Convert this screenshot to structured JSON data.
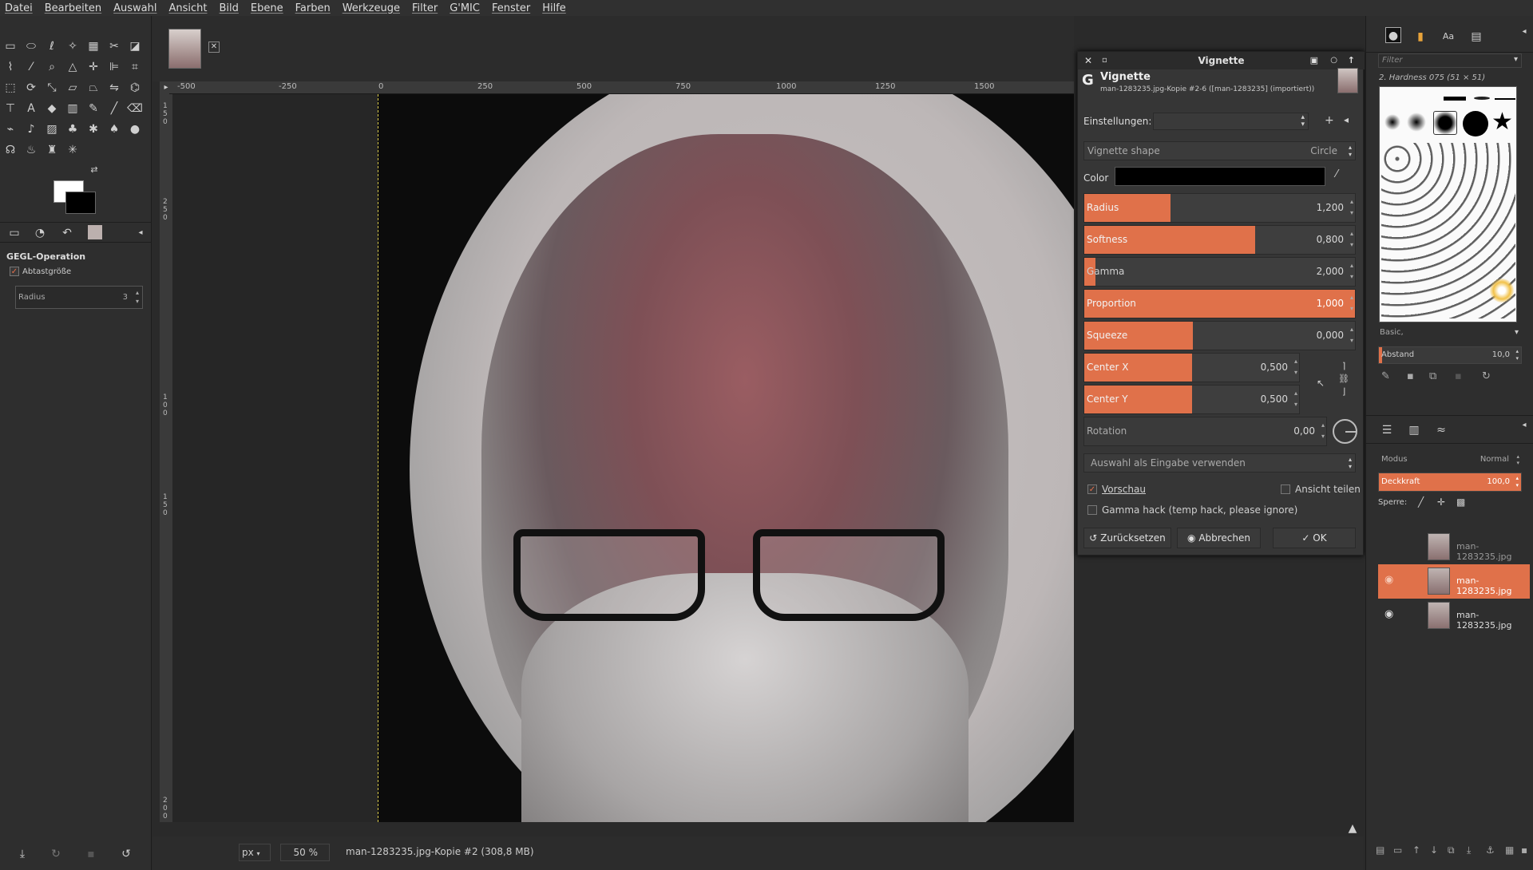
{
  "menubar": [
    "Datei",
    "Bearbeiten",
    "Auswahl",
    "Ansicht",
    "Bild",
    "Ebene",
    "Farben",
    "Werkzeuge",
    "Filter",
    "G'MIC",
    "Fenster",
    "Hilfe"
  ],
  "tool_options": {
    "title": "GEGL-Operation",
    "sample_size_label": "Abtastgröße",
    "radius_label": "Radius",
    "radius_value": "3"
  },
  "ruler": {
    "ticks": [
      "-500",
      "-250",
      "0",
      "250",
      "500",
      "750",
      "1000",
      "1250",
      "1500"
    ]
  },
  "vertical_ruler": [
    "1",
    "5",
    "0",
    "2",
    "5",
    "0",
    "1",
    "0",
    "0",
    "1",
    "5",
    "0",
    "2",
    "0",
    "0"
  ],
  "status": {
    "unit": "px",
    "zoom": "50 %",
    "file": "man-1283235.jpg-Kopie #2 (308,8 MB)"
  },
  "dialog": {
    "window_title": "Vignette",
    "heading": "Vignette",
    "subtitle": "man-1283235.jpg-Kopie #2-6 ([man-1283235] (importiert))",
    "presets_label": "Einstellungen:",
    "shape_label": "Vignette shape",
    "shape_value": "Circle",
    "color_label": "Color",
    "color_value": "#000000",
    "sliders": [
      {
        "label": "Radius",
        "value": "1,200",
        "fraction": 0.32
      },
      {
        "label": "Softness",
        "value": "0,800",
        "fraction": 0.63
      },
      {
        "label": "Gamma",
        "value": "2,000",
        "fraction": 0.04
      },
      {
        "label": "Proportion",
        "value": "1,000",
        "fraction": 1.0
      },
      {
        "label": "Squeeze",
        "value": "0,000",
        "fraction": 0.4
      },
      {
        "label": "Center X",
        "value": "0,500",
        "fraction": 0.5
      },
      {
        "label": "Center Y",
        "value": "0,500",
        "fraction": 0.5
      },
      {
        "label": "Rotation",
        "value": "0,00",
        "fraction": 0.0
      }
    ],
    "input_select": "Auswahl als Eingabe verwenden",
    "preview_label": "Vorschau",
    "split_label": "Ansicht teilen",
    "gamma_hack_label": "Gamma hack (temp hack, please ignore)",
    "reset_label": "Zurücksetzen",
    "cancel_label": "Abbrechen",
    "ok_label": "OK"
  },
  "right_dock": {
    "filter_placeholder": "Filter",
    "brush_name": "2. Hardness 075 (51 × 51)",
    "brush_set": "Basic,",
    "spacing_label": "Abstand",
    "spacing_value": "10,0",
    "mode_label": "Modus",
    "mode_value": "Normal",
    "opacity_label": "Deckkraft",
    "opacity_value": "100,0",
    "lock_label": "Sperre:",
    "layers": [
      "man-1283235.jpg",
      "man-1283235.jpg",
      "man-1283235.jpg"
    ]
  },
  "accent_color": "#e0714a"
}
